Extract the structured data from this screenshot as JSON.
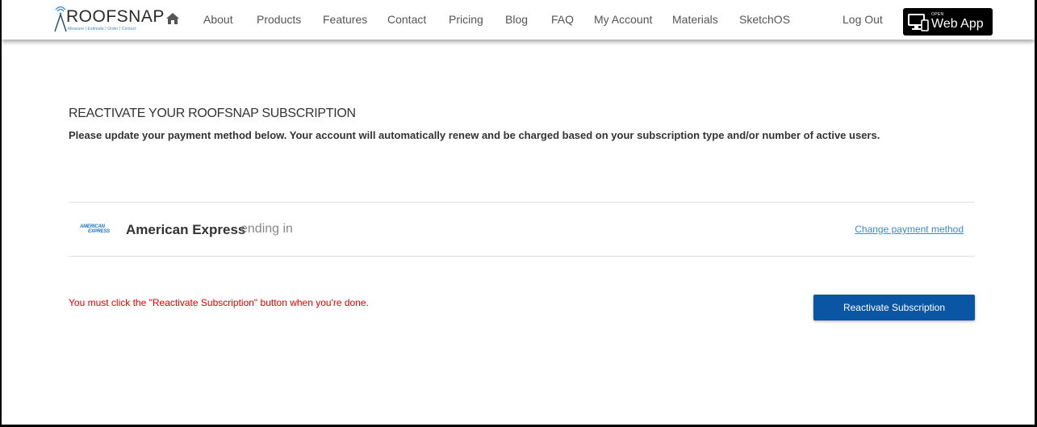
{
  "header": {
    "logo": {
      "brand": "ROOFSNAP",
      "tagline": "Measure | Estimate | Order | Contact"
    },
    "home_icon": "home-icon",
    "nav": [
      {
        "label": "About"
      },
      {
        "label": "Products"
      },
      {
        "label": "Features"
      },
      {
        "label": "Contact"
      },
      {
        "label": "Pricing"
      },
      {
        "label": "Blog"
      },
      {
        "label": "FAQ"
      },
      {
        "label": "My Account"
      },
      {
        "label": "Materials"
      },
      {
        "label": "SketchOS"
      }
    ],
    "logout_label": "Log Out",
    "webapp": {
      "small": "OPEN",
      "big": "Web App",
      "icon": "monitor-icon"
    }
  },
  "main": {
    "heading": "REACTIVATE YOUR ROOFSNAP SUBSCRIPTION",
    "subtext": "Please update your payment method below. Your account will automatically renew and be charged based on your subscription type and/or number of active users.",
    "payment": {
      "card_logo_line1": "AMERICAN",
      "card_logo_line2": "EXPRESS",
      "card_name": "American Express",
      "card_suffix": "ending in",
      "change_label": "Change payment method"
    },
    "warning": "You must click the \"Reactivate Subscription\" button when you're done.",
    "reactivate_label": "Reactivate Subscription"
  },
  "colors": {
    "primary_button": "#0b56a4",
    "link": "#3a8bc7",
    "warning": "#e00000",
    "amex_blue": "#1c77c3"
  }
}
